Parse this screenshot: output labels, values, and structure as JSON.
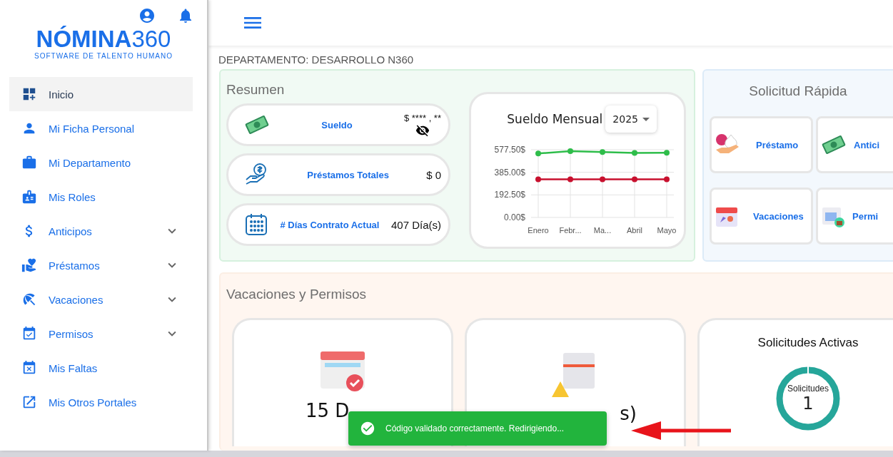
{
  "sidebar": {
    "logo": {
      "name": "NÓMINA",
      "number": "360",
      "tagline": "SOFTWARE DE TALENTO HUMANO"
    },
    "items": [
      {
        "label": "Inicio",
        "selected": true
      },
      {
        "label": "Mi Ficha Personal",
        "selected": false
      },
      {
        "label": "Mi Departamento",
        "selected": false
      },
      {
        "label": "Mis Roles",
        "selected": false
      },
      {
        "label": "Anticipos",
        "selected": false,
        "expanded": false
      },
      {
        "label": "Préstamos",
        "selected": false,
        "expanded": false
      },
      {
        "label": "Vacaciones",
        "selected": false,
        "expanded": false
      },
      {
        "label": "Permisos",
        "selected": false,
        "expanded": false
      },
      {
        "label": "Mis Faltas",
        "selected": false
      },
      {
        "label": "Mis Otros Portales",
        "selected": false
      }
    ]
  },
  "department": "DEPARTAMENTO: DESARROLLO N360",
  "resumen": {
    "title": "Resumen",
    "stats": [
      {
        "label": "Sueldo",
        "value": "$ **** , **",
        "hidden": true
      },
      {
        "label": "Préstamos Totales",
        "value": "$ 0"
      },
      {
        "label": "# Días Contrato Actual",
        "value": "407 Día(s)"
      }
    ],
    "chart": {
      "title": "Sueldo Mensual",
      "year": "2025",
      "chart_data": {
        "type": "line",
        "grid": true,
        "categories": [
          "Enero",
          "Febr...",
          "Ma...",
          "Abril",
          "Mayo"
        ],
        "ylim": [
          0,
          577.5
        ],
        "yticks": [
          {
            "value": 0,
            "label": "0.00$"
          },
          {
            "value": 192.5,
            "label": "192.50$"
          },
          {
            "value": 385,
            "label": "385.00$"
          },
          {
            "value": 577.5,
            "label": "577.50$"
          }
        ],
        "series": [
          {
            "color": "#2ebd4a",
            "marker": "circle",
            "values": [
              545,
              565,
              557,
              550,
              552
            ]
          },
          {
            "color": "#c8102e",
            "marker": "circle",
            "values": [
              325,
              325,
              325,
              325,
              325
            ]
          }
        ]
      }
    }
  },
  "quick": {
    "title": "Solicitud Rápida",
    "items": [
      {
        "label": "Préstamo"
      },
      {
        "label": "Antici"
      },
      {
        "label": "Vacaciones"
      },
      {
        "label": "Permi"
      }
    ]
  },
  "vacaciones": {
    "title": "Vacaciones y Permisos",
    "cards": [
      {
        "value": "15 D"
      },
      {
        "value": "s)"
      }
    ],
    "active": {
      "title": "Solicitudes Activas",
      "label": "Solicitudes",
      "count": "1"
    }
  },
  "toast": {
    "message": "Código validado correctamente. Redirigiendo..."
  }
}
